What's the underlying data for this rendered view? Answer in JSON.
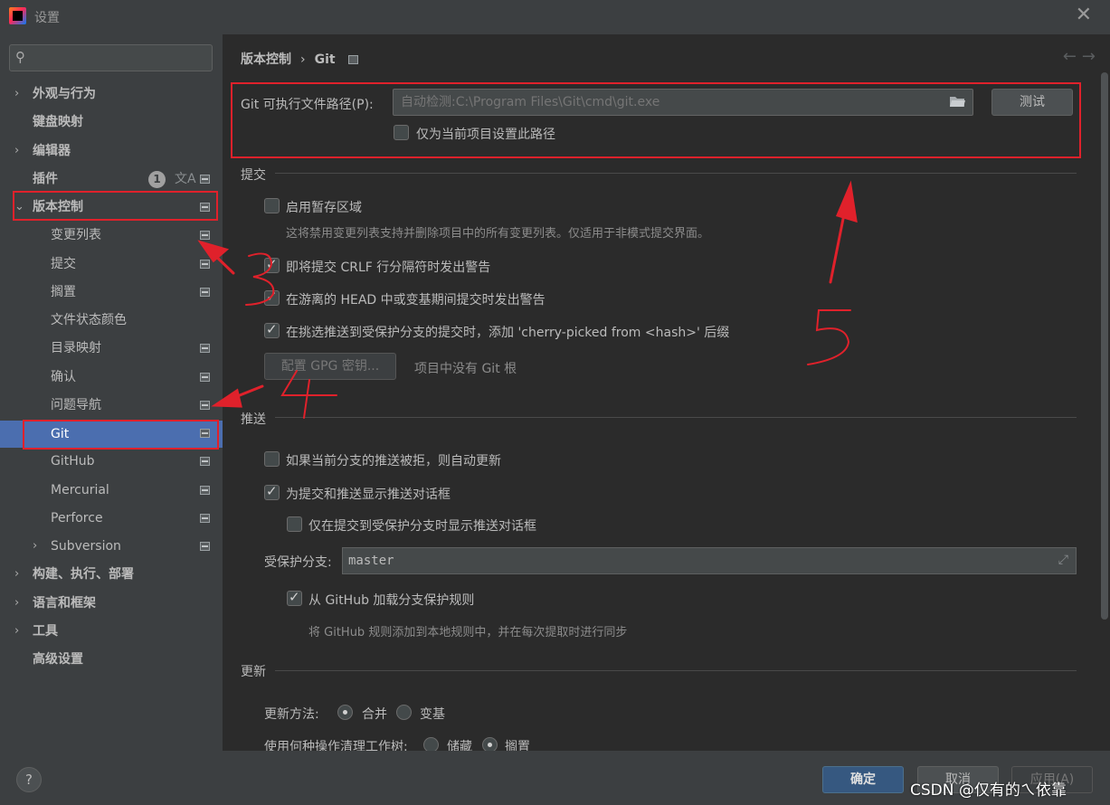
{
  "window": {
    "title": "设置"
  },
  "sidebar": {
    "search_placeholder": "",
    "items": [
      {
        "label": "外观与行为",
        "arrow": "›"
      },
      {
        "label": "键盘映射"
      },
      {
        "label": "编辑器",
        "arrow": "›"
      },
      {
        "label": "插件",
        "badge": "1"
      },
      {
        "label": "版本控制",
        "arrow": "⌄"
      },
      {
        "label": "变更列表"
      },
      {
        "label": "提交"
      },
      {
        "label": "搁置"
      },
      {
        "label": "文件状态颜色"
      },
      {
        "label": "目录映射"
      },
      {
        "label": "确认"
      },
      {
        "label": "问题导航"
      },
      {
        "label": "Git"
      },
      {
        "label": "GitHub"
      },
      {
        "label": "Mercurial"
      },
      {
        "label": "Perforce"
      },
      {
        "label": "Subversion",
        "arrow": "›"
      },
      {
        "label": "构建、执行、部署",
        "arrow": "›"
      },
      {
        "label": "语言和框架",
        "arrow": "›"
      },
      {
        "label": "工具",
        "arrow": "›"
      },
      {
        "label": "高级设置"
      }
    ]
  },
  "breadcrumb": {
    "parent": "版本控制",
    "sep": "›",
    "current": "Git"
  },
  "nav": {
    "back": "←",
    "forward": "→"
  },
  "git_path": {
    "label": "Git 可执行文件路径(P):",
    "placeholder": "自动检测:C:\\Program Files\\Git\\cmd\\git.exe",
    "test_button": "测试",
    "project_only": "仅为当前项目设置此路径"
  },
  "commit": {
    "title": "提交",
    "staging": "启用暂存区域",
    "staging_hint": "这将禁用变更列表支持并删除项目中的所有变更列表。仅适用于非模式提交界面。",
    "crlf": "即将提交 CRLF 行分隔符时发出警告",
    "detached": "在游离的 HEAD 中或变基期间提交时发出警告",
    "cherry": "在挑选推送到受保护分支的提交时，添加 'cherry-picked from <hash>' 后缀",
    "gpg_button": "配置 GPG 密钥...",
    "gpg_hint": "项目中没有 Git 根"
  },
  "push": {
    "title": "推送",
    "auto_update": "如果当前分支的推送被拒，则自动更新",
    "show_dialog": "为提交和推送显示推送对话框",
    "protected_only": "仅在提交到受保护分支时显示推送对话框",
    "protected_label": "受保护分支:",
    "protected_value": "master",
    "github_rules": "从 GitHub 加载分支保护规则",
    "github_hint": "将 GitHub 规则添加到本地规则中，并在每次提取时进行同步"
  },
  "update": {
    "title": "更新",
    "method_label": "更新方法:",
    "merge": "合并",
    "rebase": "变基",
    "clean_label": "使用何种操作清理工作树:",
    "stash": "储藏",
    "shelve": "搁置"
  },
  "footer": {
    "help": "?",
    "ok": "确定",
    "cancel": "取消",
    "apply": "应用(A)",
    "watermark": "CSDN @仅有的ㄟ依靠"
  },
  "colors": {
    "annotation": "#e0212b",
    "selected": "#4b6eaf",
    "ok_button": "#365880"
  }
}
